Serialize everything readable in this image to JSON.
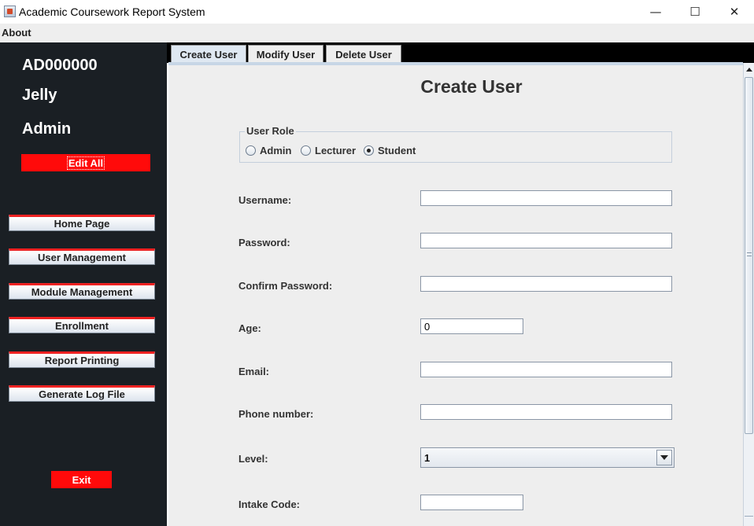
{
  "window": {
    "title": "Academic Coursework Report System",
    "minimize": "—",
    "maximize": "☐",
    "close": "✕"
  },
  "menu": {
    "items": [
      "About"
    ]
  },
  "sidebar": {
    "user_id": "AD000000",
    "user_name": "Jelly",
    "user_role": "Admin",
    "edit_all": "Edit All",
    "nav": [
      "Home Page",
      "User Management",
      "Module Management",
      "Enrollment",
      "Report Printing",
      "Generate Log File"
    ],
    "exit": "Exit"
  },
  "tabs": [
    {
      "label": "Create User",
      "active": true
    },
    {
      "label": "Modify User",
      "active": false
    },
    {
      "label": "Delete User",
      "active": false
    }
  ],
  "form": {
    "title": "Create User",
    "role_group": {
      "legend": "User Role",
      "options": [
        "Admin",
        "Lecturer",
        "Student"
      ],
      "selected": "Student"
    },
    "labels": {
      "username": "Username:",
      "password": "Password:",
      "confirm_password": "Confirm Password:",
      "age": "Age:",
      "email": "Email:",
      "phone": "Phone number:",
      "level": "Level:",
      "intake": "Intake Code:"
    },
    "values": {
      "username": "",
      "password": "",
      "confirm_password": "",
      "age": "0",
      "email": "",
      "phone": "",
      "level": "1",
      "intake": ""
    }
  },
  "colors": {
    "sidebar_bg": "#1a1f24",
    "accent_red": "#ff0a0a",
    "panel_bg": "#eeeeee",
    "tab_bar_bg": "#000000"
  }
}
